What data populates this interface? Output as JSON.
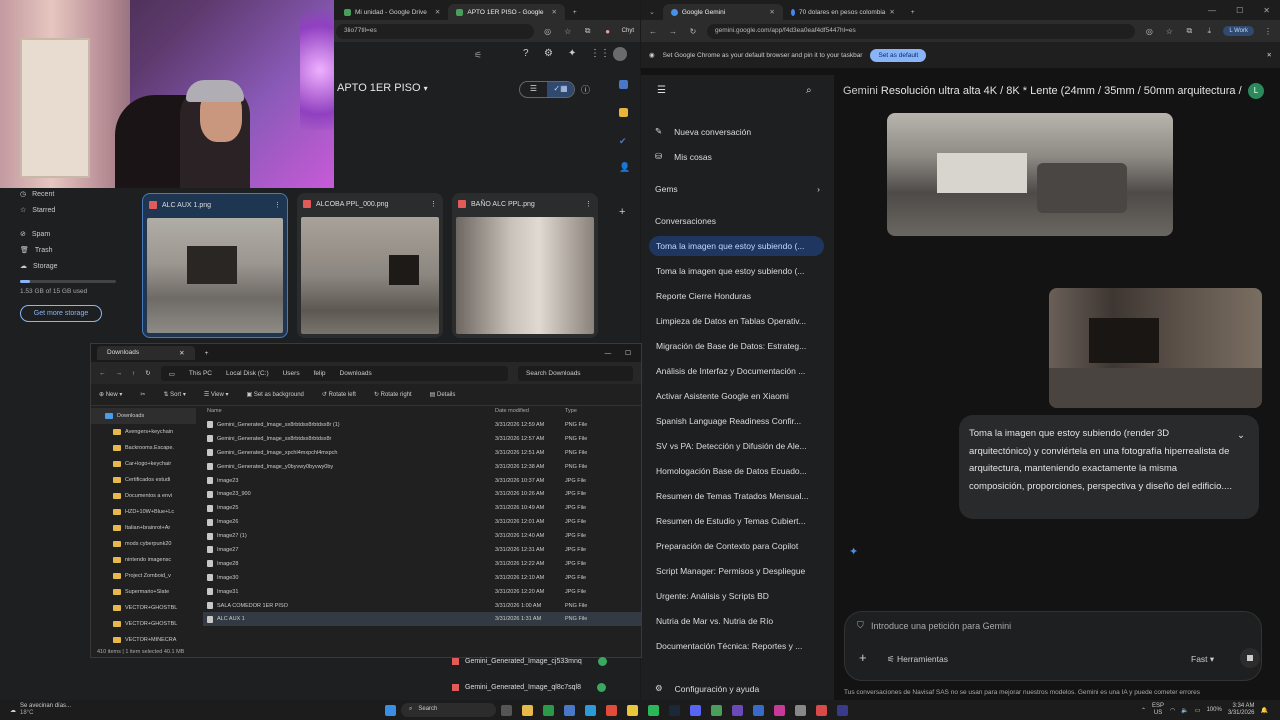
{
  "left_browser": {
    "tabs": [
      {
        "label": "Mi unidad - Google Drive"
      },
      {
        "label": "APTO 1ER PISO - Google"
      },
      {
        "label": "Chyt"
      }
    ],
    "url": "3lio77tll=es",
    "drive": {
      "folder_title": "APTO 1ER PISO",
      "sidebar": [
        {
          "label": "Recent",
          "icon": "clock-icon"
        },
        {
          "label": "Starred",
          "icon": "star-icon"
        },
        {
          "label": "Spam",
          "icon": "spam-icon"
        },
        {
          "label": "Trash",
          "icon": "trash-icon"
        },
        {
          "label": "Storage",
          "icon": "cloud-icon"
        }
      ],
      "storage_used": "1.53 GB of 15 GB used",
      "storage_fraction": 0.1,
      "get_more_label": "Get more storage",
      "files": [
        {
          "name": "ALC AUX 1.png"
        },
        {
          "name": "ALCOBA PPL_000.png"
        },
        {
          "name": "BAÑO ALC PPL.png"
        }
      ]
    }
  },
  "explorer": {
    "tab_title": "Downloads",
    "breadcrumb": [
      "This PC",
      "Local Disk (C:)",
      "Users",
      "felip",
      "Downloads"
    ],
    "search_placeholder": "Search Downloads",
    "toolbar": {
      "new": "New",
      "sort": "Sort",
      "view": "View",
      "set_bg": "Set as background",
      "rotate_left": "Rotate left",
      "rotate_right": "Rotate right",
      "details": "Details"
    },
    "tree": [
      {
        "label": "Downloads"
      },
      {
        "label": "Avengers+keychain"
      },
      {
        "label": "Backrooms.Escape."
      },
      {
        "label": "Car+logo+keychair"
      },
      {
        "label": "Certificados estudi"
      },
      {
        "label": "Documentos a envi"
      },
      {
        "label": "HZD+10W+Blue+Lc"
      },
      {
        "label": "Italian+brainrot+Ar"
      },
      {
        "label": "mods cyberpunk20"
      },
      {
        "label": "nintendo imagensc"
      },
      {
        "label": "Project Zomboid_v"
      },
      {
        "label": "Supermario+Slate"
      },
      {
        "label": "VECTOR+GHOSTBL"
      },
      {
        "label": "VECTOR+GHOSTBL"
      },
      {
        "label": "VECTOR+MINECRA"
      }
    ],
    "columns": {
      "name": "Name",
      "date": "Date modified",
      "type": "Type"
    },
    "rows": [
      {
        "name": "Gemini_Generated_Image_sx8rbtdsx8rbtdsx8r (1)",
        "date": "3/31/2026 12:59 AM",
        "type": "PNG File"
      },
      {
        "name": "Gemini_Generated_Image_sx8rbtdsx8rbtdsx8r",
        "date": "3/31/2026 12:57 AM",
        "type": "PNG File"
      },
      {
        "name": "Gemini_Generated_Image_xpchl4mxpchl4mxpch",
        "date": "3/31/2026 12:51 AM",
        "type": "PNG File"
      },
      {
        "name": "Gemini_Generated_Image_y0byvwy0byvwy0by",
        "date": "3/31/2026 12:38 AM",
        "type": "PNG File"
      },
      {
        "name": "Image23",
        "date": "3/31/2026 10:37 AM",
        "type": "JPG File"
      },
      {
        "name": "Image23_900",
        "date": "3/31/2026 10:26 AM",
        "type": "JPG File"
      },
      {
        "name": "Image25",
        "date": "3/31/2026 10:49 AM",
        "type": "JPG File"
      },
      {
        "name": "Image26",
        "date": "3/31/2026 12:01 AM",
        "type": "JPG File"
      },
      {
        "name": "Image27 (1)",
        "date": "3/31/2026 12:40 AM",
        "type": "JPG File"
      },
      {
        "name": "Image27",
        "date": "3/31/2026 12:31 AM",
        "type": "JPG File"
      },
      {
        "name": "Image28",
        "date": "3/31/2026 12:22 AM",
        "type": "JPG File"
      },
      {
        "name": "Image30",
        "date": "3/31/2026 12:10 AM",
        "type": "JPG File"
      },
      {
        "name": "Image31",
        "date": "3/31/2026 12:20 AM",
        "type": "JPG File"
      },
      {
        "name": "SALA COMEDOR 1ER PISO",
        "date": "3/31/2026 1:00 AM",
        "type": "PNG File"
      },
      {
        "name": "ALC AUX 1",
        "date": "3/31/2026 1:31 AM",
        "type": "PNG File"
      }
    ],
    "status": "410 items  |  1 item selected  40.1 MB"
  },
  "downloads_bar": [
    {
      "name": "Gemini_Generated_Image_cj533mnq"
    },
    {
      "name": "Gemini_Generated_Image_ql8c7sql8"
    }
  ],
  "right_browser": {
    "tabs": [
      {
        "label": "Google Gemini"
      },
      {
        "label": "70 dolares en pesos colombia"
      }
    ],
    "url": "gemini.google.com/app/f4d3ea0eaf4df5447hl=es",
    "profile_badge": "Work",
    "infobar_text": "Set Google Chrome as your default browser and pin it to your taskbar",
    "infobar_button": "Set as default",
    "gemini": {
      "logo": "Gemini",
      "header_text": "Resolución ultra alta 4K / 8K * Lente (24mm / 35mm / 50mm arquitectura / dr",
      "avatar": "L",
      "new_chat": "Nueva conversación",
      "my_stuff": "Mis cosas",
      "gems": "Gems",
      "conversations_label": "Conversaciones",
      "conversations": [
        "Toma la imagen que estoy subiendo (...",
        "Toma la imagen que estoy subiendo (...",
        "Reporte Cierre Honduras",
        "Limpieza de Datos en Tablas Operativ...",
        "Migración de Base de Datos: Estrateg...",
        "Análisis de Interfaz y Documentación ...",
        "Activar Asistente Google en Xiaomi",
        "Spanish Language Readiness Confir...",
        "SV vs PA: Detección y Difusión de Ale...",
        "Homologación Base de Datos Ecuado...",
        "Resumen de Temas Tratados Mensual...",
        "Resumen de Estudio y Temas Cubiert...",
        "Preparación de Contexto para Copilot",
        "Script Manager: Permisos y Despliegue",
        "Urgente: Análisis y Scripts BD",
        "Nutria de Mar vs. Nutria de Río",
        "Documentación Técnica: Reportes y ..."
      ],
      "settings": "Configuración y ayuda",
      "prompt_text": "Toma la imagen que estoy subiendo (render 3D arquitectónico) y conviértela en una fotografía hiperrealista de arquitectura, manteniendo exactamente la misma composición, proporciones, perspectiva y diseño del edificio....",
      "input_placeholder": "Introduce una petición para Gemini",
      "tools_label": "Herramientas",
      "mode_label": "Fast",
      "footer_text": "Tus conversaciones de Navisaf SAS no se usan para mejorar nuestros modelos. Gemini es una IA y puede cometer errores"
    }
  },
  "taskbar": {
    "weather_title": "Se avecinan días...",
    "weather_temp": "18°C",
    "search": "Search",
    "lang": "ESP",
    "lang2": "US",
    "battery": "100%",
    "time": "3:34 AM",
    "date": "3/31/2026"
  },
  "colors": {
    "accent": "#8ab4f8",
    "active_conv": "#1f3760",
    "selected_card": "#1f3653"
  }
}
